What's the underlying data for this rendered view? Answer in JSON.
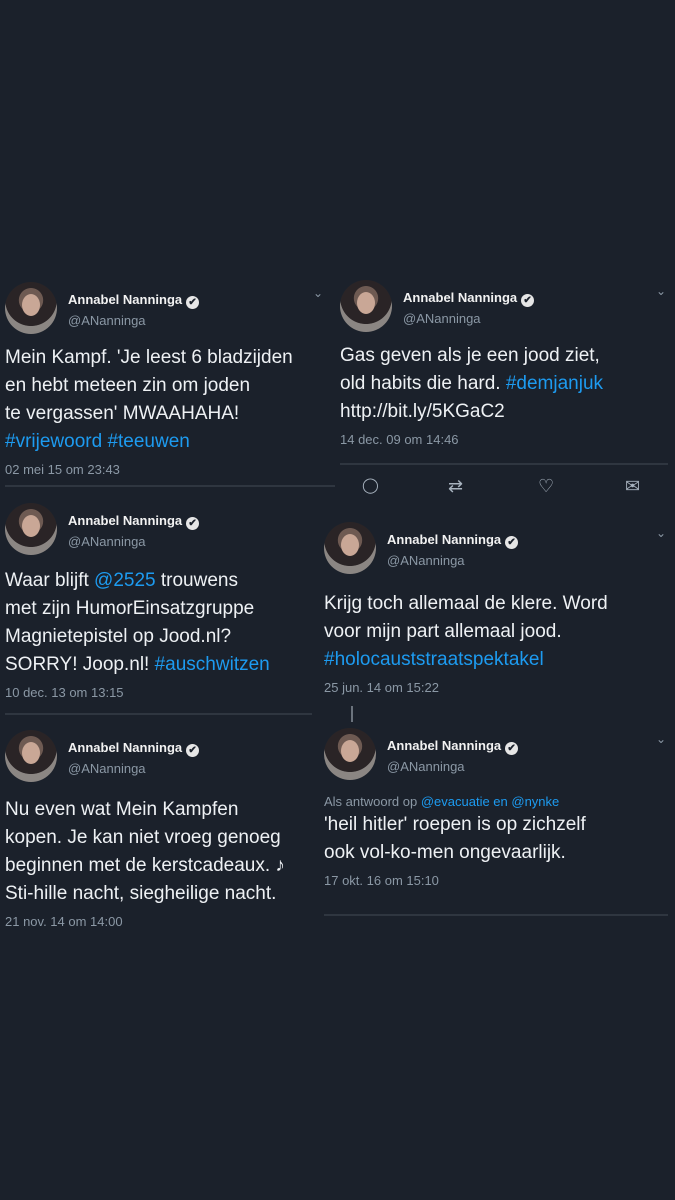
{
  "tweets": [
    {
      "name": "Annabel Nanninga",
      "handle": "@ANanninga",
      "lines": [
        "Mein Kampf. 'Je leest 6 bladzijden",
        "en hebt meteen zin om joden",
        "te vergassen' MWAAHAHA!"
      ],
      "link_line": [
        "#vrijewoord",
        "#teeuwen"
      ],
      "date": "02 mei 15 om 23:43"
    },
    {
      "name": "Annabel Nanninga",
      "handle": "@ANanninga",
      "line1": "Gas geven als je een jood ziet,",
      "line2_text": "old habits die hard. ",
      "line2_link": "#demjanjuk",
      "line3": "http://bit.ly/5KGaC2",
      "date": "14 dec. 09 om 14:46"
    },
    {
      "name": "Annabel Nanninga",
      "handle": "@ANanninga",
      "line1_text": "Waar blijft ",
      "line1_link": "@2525",
      "line1_tail": " trouwens",
      "line2": "met zijn HumorEinsatzgruppe",
      "line3": "Magnietepistel op Jood.nl?",
      "line4_text": "SORRY! Joop.nl! ",
      "line4_link": "#auschwitzen",
      "date": "10 dec. 13 om 13:15"
    },
    {
      "name": "Annabel Nanninga",
      "handle": "@ANanninga",
      "line1": "Krijg toch allemaal de klere. Word",
      "line2": "voor mijn part allemaal jood.",
      "line3_link": "#holocauststraatspektakel",
      "date": "25 jun. 14 om 15:22"
    },
    {
      "name": "Annabel Nanninga",
      "handle": "@ANanninga",
      "lines": [
        "Nu even wat Mein Kampfen",
        "kopen. Je kan niet vroeg genoeg",
        "beginnen met de kerstcadeaux. ♪",
        "Sti-hille nacht, siegheilige nacht."
      ],
      "date": "21 nov. 14 om 14:00"
    },
    {
      "name": "Annabel Nanninga",
      "handle": "@ANanninga",
      "reply_prefix": "Als antwoord op ",
      "reply_link": "@evacuatie en @nynke",
      "lines": [
        "'heil hitler' roepen is op zichzelf",
        "ook vol-ko-men ongevaarlijk."
      ],
      "date": "17 okt. 16 om 15:10"
    }
  ],
  "icons": {
    "verified": "✔",
    "chevron": "⌄",
    "reply": "◯",
    "retweet": "⇄",
    "like": "♡",
    "message": "✉"
  }
}
